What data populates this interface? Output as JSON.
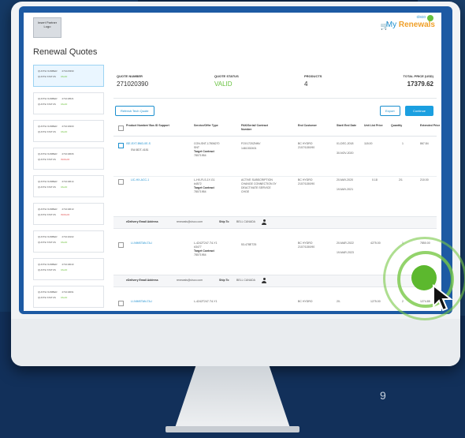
{
  "header": {
    "logo_text": "Insert Partner Logo",
    "cisco_text": "cisco",
    "brand_my": "My",
    "brand_renewals": "Renewals"
  },
  "page_title": "Renewal Quotes",
  "sidebar": {
    "quotes": [
      {
        "label_number": "QUOTE NUMBER",
        "number": "271020390",
        "label_status": "QUOTE STATUS",
        "status": "VALID",
        "status_type": "valid",
        "active": true
      },
      {
        "label_number": "QUOTE NUMBER",
        "number": "271019521",
        "label_status": "QUOTE STATUS",
        "status": "VALID",
        "status_type": "valid",
        "active": false
      },
      {
        "label_number": "QUOTE NUMBER",
        "number": "271019300",
        "label_status": "QUOTE STATUS",
        "status": "VALID",
        "status_type": "valid",
        "active": false
      },
      {
        "label_number": "QUOTE NUMBER",
        "number": "271019606",
        "label_status": "QUOTE STATUS",
        "status": "INVALID",
        "status_type": "invalid",
        "active": false
      },
      {
        "label_number": "QUOTE NUMBER",
        "number": "271019614",
        "label_status": "QUOTE STATUS",
        "status": "VALID",
        "status_type": "valid",
        "active": false
      },
      {
        "label_number": "QUOTE NUMBER",
        "number": "271019613",
        "label_status": "QUOTE STATUS",
        "status": "INVALID",
        "status_type": "invalid",
        "active": false
      },
      {
        "label_number": "QUOTE NUMBER",
        "number": "271019102",
        "label_status": "QUOTE STATUS",
        "status": "VALID",
        "status_type": "valid",
        "active": false
      },
      {
        "label_number": "QUOTE NUMBER",
        "number": "271019043",
        "label_status": "QUOTE STATUS",
        "status": "VALID",
        "status_type": "valid",
        "active": false
      },
      {
        "label_number": "QUOTE NUMBER",
        "number": "271019091",
        "label_status": "QUOTE STATUS",
        "status": "VALID",
        "status_type": "valid",
        "active": false
      }
    ]
  },
  "summary": {
    "quote_number_label": "QUOTE NUMBER",
    "quote_number": "271020390",
    "quote_status_label": "QUOTE STATUS",
    "quote_status": "VALID",
    "products_label": "PRODUCTS",
    "products": "4",
    "total_price_label": "TOTAL PRICE (USD)",
    "total_price": "17379.62"
  },
  "actions": {
    "refresh_label": "Refresh Tech Quote",
    "export_label": "Export",
    "continue_label": "Continue"
  },
  "table": {
    "headers": [
      "Product Number/ Bus ID Support",
      "Service/Offer Type",
      "PAK/Serial/ Contract Number",
      "End Customer",
      "Start/ End Date",
      "Unit List Price",
      "Quantity",
      "Extended Price"
    ],
    "rows": [
      {
        "product": "ISE-EXT-BND-0E-S",
        "sub": "SW-BDT-4181",
        "service": "CON-SNT-17806270",
        "service2": "SNT",
        "contract_label": "Target Contract",
        "contract": "78071954",
        "pak": "FOX1720ZNNV",
        "pak2": "1461302401",
        "customer": "BC HYDRO",
        "customer2": "2107/1150/90",
        "start": "01-DEC-2018",
        "end": "30-NOV-2020",
        "unit": "118.00",
        "qty": "1",
        "ext": "867.84",
        "checked": true
      },
      {
        "product": "LIC-HX-ACC-1",
        "sub": "",
        "service": "L-HX-FLS-1Y-G1",
        "service2": "#4572",
        "contract_label": "Target Contract",
        "contract": "78071954",
        "pak": "ACTIVE SUBSCRIPTION",
        "pak2": "CHANGE CONNECTION 3Y",
        "pak3": "DEACTIVATE SERVICE",
        "pak4": "CHGE",
        "customer": "BC HYDRO",
        "customer2": "2107/1150/90",
        "start": "20-MAY-2020",
        "end": "19-MAY-2021",
        "unit": "0.18",
        "qty": "2/1",
        "ext": "210.00",
        "checked": false
      }
    ],
    "delivery": {
      "label": "eDelivery Email Address",
      "email": "renewals@cisco.com",
      "ship_label": "Ship To",
      "ship": "BELL CANADA"
    },
    "row3": {
      "product": "LI-NIMSTAN-TA-I",
      "service": "L-4242T247-T4-Y1",
      "service2": "#3477",
      "contract_label": "Target Contract",
      "contract": "78071954",
      "pak": "53-478ET25",
      "customer": "BC HYDRO",
      "customer2": "2107/1150/90",
      "start": "20-MAR-2022",
      "end": "19-MAR-2023",
      "unit": "4275.00",
      "qty": "1",
      "ext": "7850.00"
    },
    "row4": {
      "product": "LI-NIMSTAN-TA-I",
      "service": "L-4242T247-T4-Y1",
      "customer": "BC HYDRO",
      "start": "20-",
      "unit": "1275.00",
      "qty": "2",
      "ext": "1274.85"
    }
  },
  "page_number": "9"
}
